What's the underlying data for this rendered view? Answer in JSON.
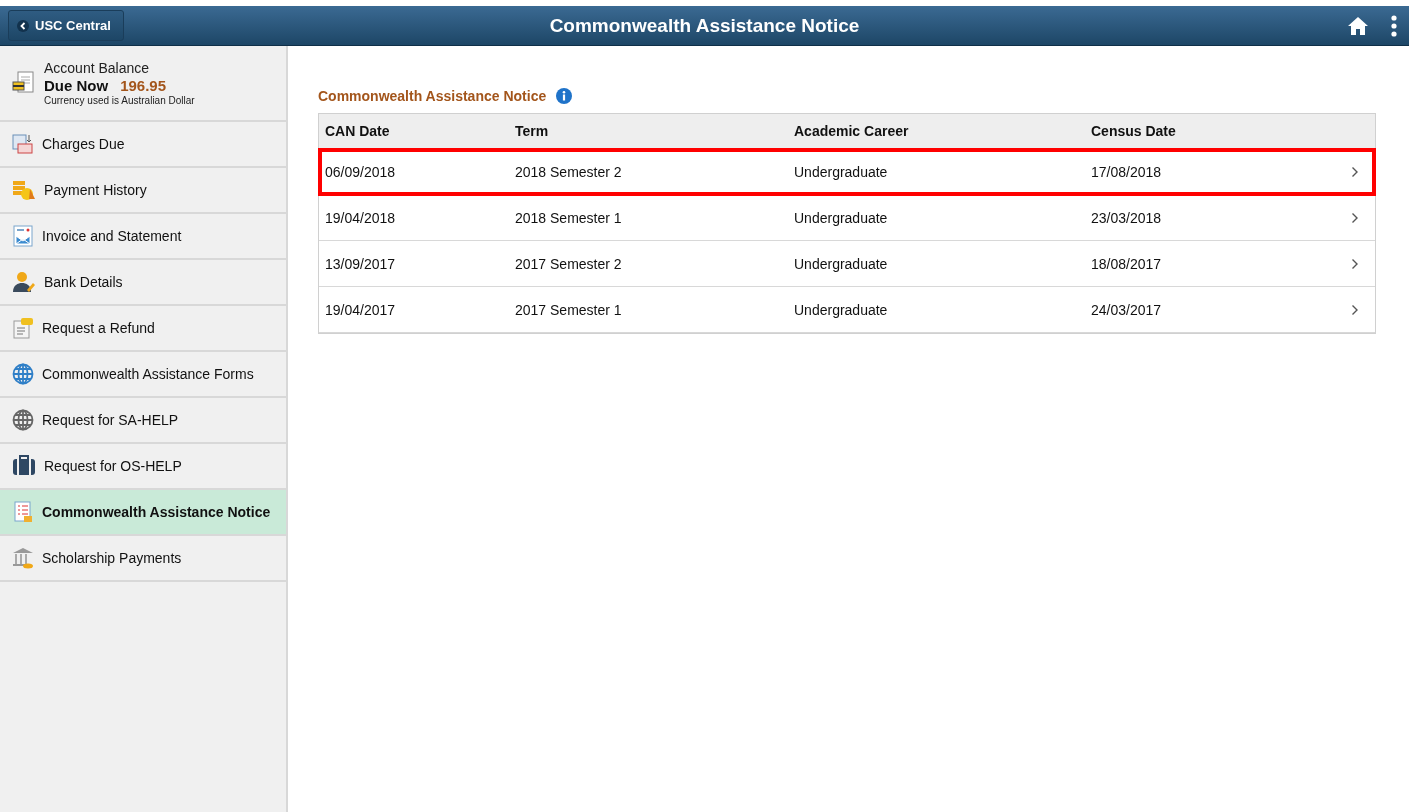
{
  "header": {
    "back_button": "USC Central",
    "title": "Commonwealth Assistance Notice"
  },
  "sidebar": {
    "account": {
      "label": "Account Balance",
      "due_label": "Due Now",
      "due_amount": "196.95",
      "note": "Currency used is Australian Dollar"
    },
    "items": [
      {
        "label": "Charges Due",
        "selected": false
      },
      {
        "label": "Payment History",
        "selected": false
      },
      {
        "label": "Invoice and Statement",
        "selected": false
      },
      {
        "label": "Bank Details",
        "selected": false
      },
      {
        "label": "Request a Refund",
        "selected": false
      },
      {
        "label": "Commonwealth Assistance Forms",
        "selected": false
      },
      {
        "label": "Request for SA-HELP",
        "selected": false
      },
      {
        "label": "Request for OS-HELP",
        "selected": false
      },
      {
        "label": "Commonwealth Assistance Notice",
        "selected": true
      },
      {
        "label": "Scholarship Payments",
        "selected": false
      }
    ]
  },
  "content": {
    "title": "Commonwealth Assistance Notice",
    "table": {
      "columns": [
        "CAN Date",
        "Term",
        "Academic Career",
        "Census Date"
      ],
      "rows": [
        {
          "cells": [
            "06/09/2018",
            "2018 Semester 2",
            "Undergraduate",
            "17/08/2018"
          ],
          "highlighted": true
        },
        {
          "cells": [
            "19/04/2018",
            "2018 Semester 1",
            "Undergraduate",
            "23/03/2018"
          ],
          "highlighted": false
        },
        {
          "cells": [
            "13/09/2017",
            "2017 Semester 2",
            "Undergraduate",
            "18/08/2017"
          ],
          "highlighted": false
        },
        {
          "cells": [
            "19/04/2017",
            "2017 Semester 1",
            "Undergraduate",
            "24/03/2017"
          ],
          "highlighted": false
        }
      ]
    }
  }
}
